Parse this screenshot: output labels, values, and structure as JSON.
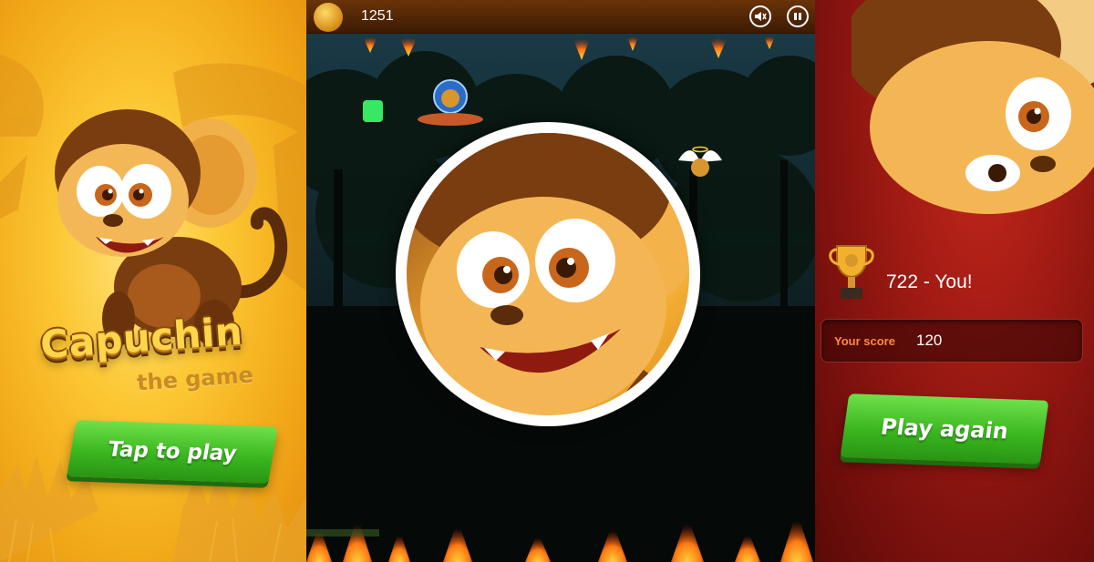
{
  "left": {
    "title": "Capuchin",
    "subtitle": "the game",
    "play_button": "Tap to play"
  },
  "game": {
    "score": "1251",
    "icons": [
      "coin-avatar-icon",
      "mute-sound-icon",
      "pause-icon",
      "fire-icon",
      "angel-monkey-icon",
      "bubble-monkey-icon",
      "green-gem-icon"
    ]
  },
  "result": {
    "best_score": "722 - You!",
    "your_score_label": "Your score",
    "your_score_value": "120",
    "play_again_button": "Play again"
  },
  "colors": {
    "accent_green": "#3ab71f",
    "left_bg": "#fcc733",
    "right_bg": "#8e1510",
    "topbar": "#5a2a06"
  }
}
